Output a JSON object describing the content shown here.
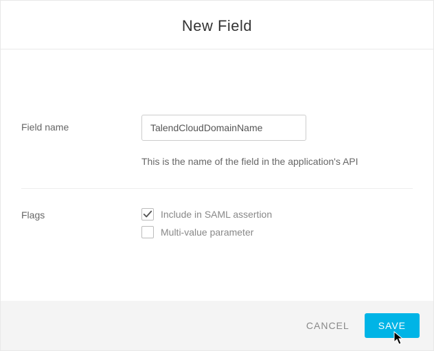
{
  "dialog": {
    "title": "New Field"
  },
  "fieldName": {
    "label": "Field name",
    "value": "TalendCloudDomainName",
    "helpText": "This is the name of the field in the application's API"
  },
  "flags": {
    "label": "Flags",
    "options": [
      {
        "label": "Include in SAML assertion",
        "checked": true
      },
      {
        "label": "Multi-value parameter",
        "checked": false
      }
    ]
  },
  "footer": {
    "cancel": "CANCEL",
    "save": "SAVE"
  }
}
